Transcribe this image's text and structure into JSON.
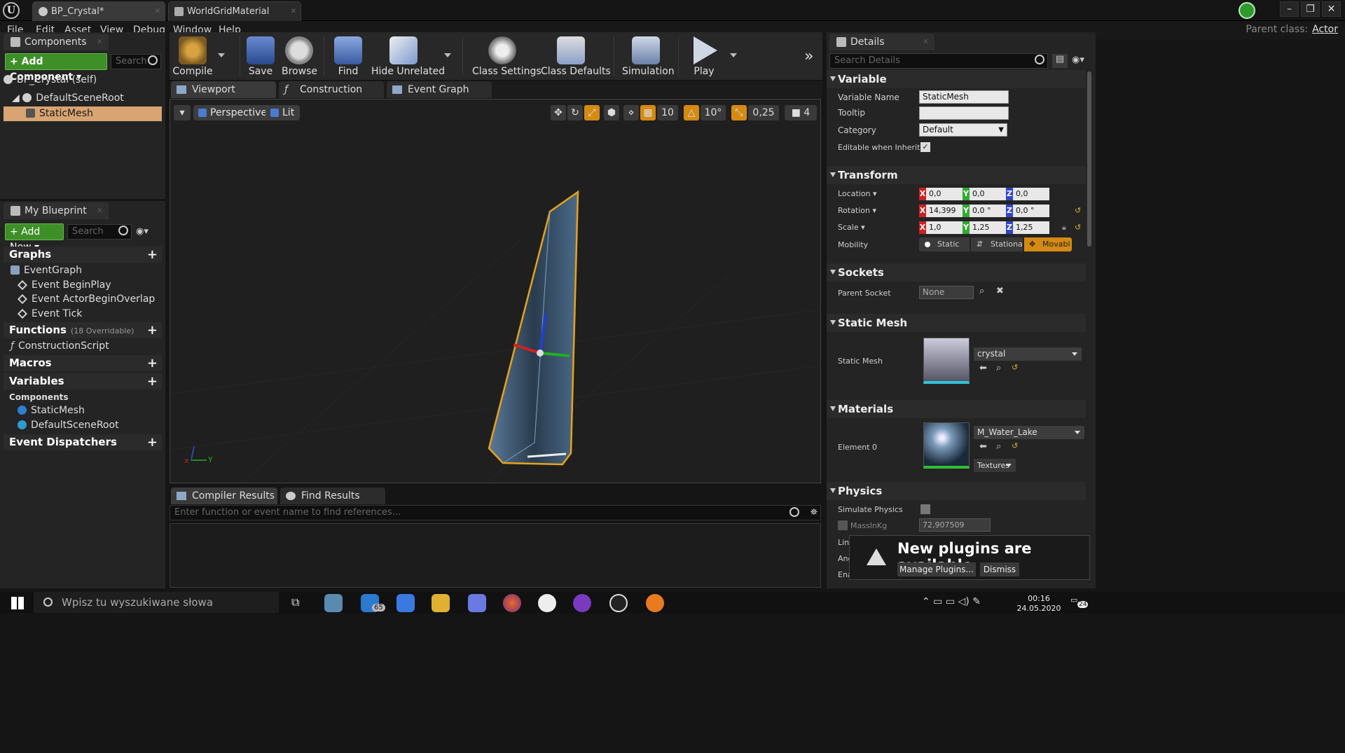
{
  "window": {
    "tabs": [
      {
        "label": "BP_Crystal*"
      },
      {
        "label": "WorldGridMaterial"
      }
    ],
    "parent_class_label": "Parent class:",
    "parent_class_value": "Actor"
  },
  "menu": [
    "File",
    "Edit",
    "Asset",
    "View",
    "Debug",
    "Window",
    "Help"
  ],
  "components_panel": {
    "tab": "Components",
    "add_button": "+ Add Component",
    "search_placeholder": "Search",
    "self_label": "BP_Crystal (self)",
    "tree": [
      "DefaultSceneRoot",
      "StaticMesh"
    ]
  },
  "my_blueprint": {
    "tab": "My Blueprint",
    "add_new": "+ Add New",
    "search_placeholder": "Search",
    "sections": {
      "graphs": "Graphs",
      "event_graph": "EventGraph",
      "events": [
        "Event BeginPlay",
        "Event ActorBeginOverlap",
        "Event Tick"
      ],
      "functions": "Functions",
      "functions_sub": "(18 Overridable)",
      "construction_script": "ConstructionScript",
      "macros": "Macros",
      "variables": "Variables",
      "components": "Components",
      "component_vars": [
        "StaticMesh",
        "DefaultSceneRoot"
      ],
      "event_dispatchers": "Event Dispatchers"
    }
  },
  "toolbar": {
    "compile": "Compile",
    "save": "Save",
    "browse": "Browse",
    "find": "Find",
    "hide_unrelated": "Hide Unrelated",
    "class_settings": "Class Settings",
    "class_defaults": "Class Defaults",
    "simulation": "Simulation",
    "play": "Play"
  },
  "editor_tabs": [
    "Viewport",
    "Construction Scrip",
    "Event Graph"
  ],
  "viewport": {
    "perspective": "Perspective",
    "lit": "Lit",
    "grid_snap": "10",
    "rot_snap": "10°",
    "scale_snap": "0,25",
    "camera_speed": "4",
    "axis_y": "Y"
  },
  "bottom_panel": {
    "tabs": [
      "Compiler Results",
      "Find Results"
    ],
    "find_placeholder": "Enter function or event name to find references..."
  },
  "details": {
    "tab": "Details",
    "search_placeholder": "Search Details",
    "variable": {
      "header": "Variable",
      "name_label": "Variable Name",
      "name_value": "StaticMesh",
      "tooltip_label": "Tooltip",
      "category_label": "Category",
      "category_value": "Default",
      "editable_label": "Editable when Inherited"
    },
    "transform": {
      "header": "Transform",
      "location_label": "Location",
      "location": [
        "0,0",
        "0,0",
        "0,0"
      ],
      "rotation_label": "Rotation",
      "rotation": [
        "14,399",
        "0,0 °",
        "0,0 °"
      ],
      "scale_label": "Scale",
      "scale": [
        "1,0",
        "1,25",
        "1,25"
      ],
      "mobility_label": "Mobility",
      "mobility_options": [
        "Static",
        "Stationa",
        "Movabl"
      ]
    },
    "sockets": {
      "header": "Sockets",
      "parent_label": "Parent Socket",
      "parent_value": "None"
    },
    "static_mesh": {
      "header": "Static Mesh",
      "label": "Static Mesh",
      "value": "crystal"
    },
    "materials": {
      "header": "Materials",
      "label": "Element 0",
      "value": "M_Water_Lake",
      "textures": "Textures"
    },
    "physics": {
      "header": "Physics",
      "simulate_label": "Simulate Physics",
      "mass_label": "MassInKg",
      "mass_value": "72,907509",
      "cut_labels": [
        "Lin",
        "Ang",
        "Ena"
      ]
    }
  },
  "notification": {
    "title": "New plugins are available",
    "manage": "Manage Plugins...",
    "dismiss": "Dismiss"
  },
  "taskbar": {
    "search_placeholder": "Wpisz tu wyszukiwane słowa",
    "mail_badge": "65",
    "time": "00:16",
    "date": "24.05.2020",
    "notif_count": "24"
  },
  "colors": {
    "accent_green": "#3f8f29",
    "selection": "#d8a472",
    "snap_orange": "#d58a13",
    "selection_outline": "#e8a21a"
  }
}
